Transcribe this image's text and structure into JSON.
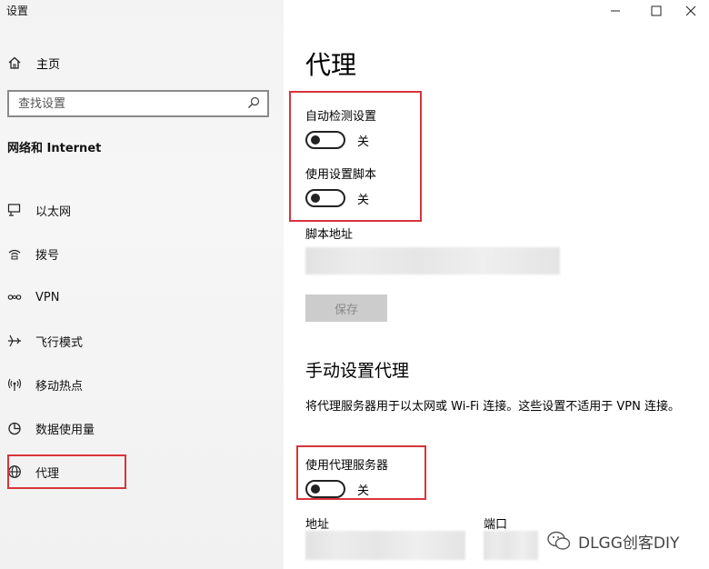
{
  "app": {
    "title": "设置"
  },
  "sidebar": {
    "home": "主页",
    "search_placeholder": "查找设置",
    "section_title": "网络和 Internet",
    "items": [
      {
        "label": "以太网",
        "icon": "ethernet-icon"
      },
      {
        "label": "拨号",
        "icon": "dialup-icon"
      },
      {
        "label": "VPN",
        "icon": "vpn-icon"
      },
      {
        "label": "飞行模式",
        "icon": "airplane-icon"
      },
      {
        "label": "移动热点",
        "icon": "hotspot-icon"
      },
      {
        "label": "数据使用量",
        "icon": "data-usage-icon"
      },
      {
        "label": "代理",
        "icon": "globe-icon",
        "selected": true
      }
    ]
  },
  "main": {
    "title": "代理",
    "auto_detect": {
      "label": "自动检测设置",
      "state": "关",
      "on": false
    },
    "use_script": {
      "label": "使用设置脚本",
      "state": "关",
      "on": false
    },
    "script_address_label": "脚本地址",
    "save_button": "保存",
    "manual_heading": "手动设置代理",
    "manual_desc": "将代理服务器用于以太网或 Wi-Fi 连接。这些设置不适用于 VPN 连接。",
    "use_proxy": {
      "label": "使用代理服务器",
      "state": "关",
      "on": false
    },
    "address_label": "地址",
    "port_label": "端口"
  },
  "watermark": "DLGG创客DIY",
  "colors": {
    "highlight": "#d8343a",
    "sidebar_bg": "#f3f3f3",
    "disabled_button": "#cccccc"
  }
}
